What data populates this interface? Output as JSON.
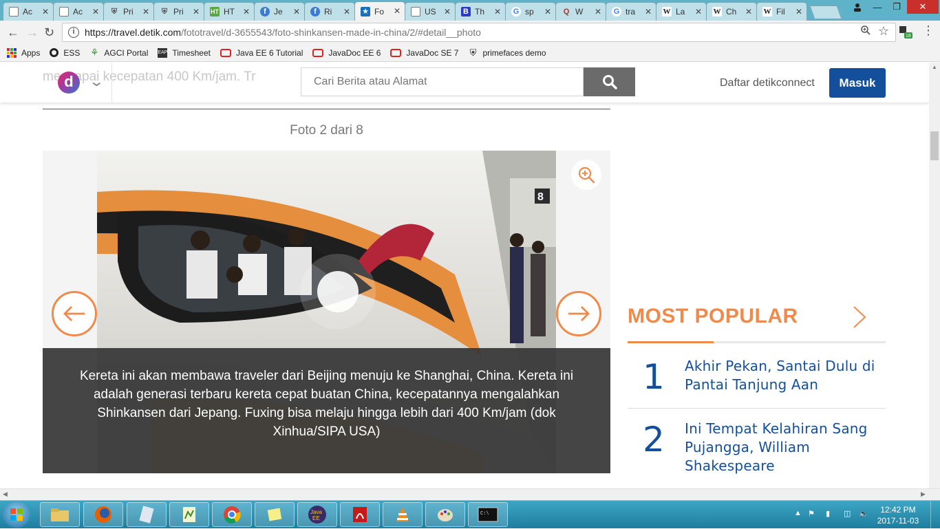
{
  "browser": {
    "tabs": [
      {
        "title": "Ac",
        "favicon": "doc-icon"
      },
      {
        "title": "Ac",
        "favicon": "doc-icon"
      },
      {
        "title": "Pri",
        "favicon": "shield-icon"
      },
      {
        "title": "Pri",
        "favicon": "shield-icon"
      },
      {
        "title": "HT",
        "favicon": "ht-icon"
      },
      {
        "title": "Je",
        "favicon": "facebook-icon"
      },
      {
        "title": "Ri",
        "favicon": "facebook-icon"
      },
      {
        "title": "Fo",
        "favicon": "detik-icon",
        "active": true
      },
      {
        "title": "US",
        "favicon": "doc-icon"
      },
      {
        "title": "Th",
        "favicon": "b-icon"
      },
      {
        "title": "sp",
        "favicon": "google-icon"
      },
      {
        "title": "W",
        "favicon": "quora-icon"
      },
      {
        "title": "tra",
        "favicon": "google-icon"
      },
      {
        "title": "La",
        "favicon": "wikipedia-icon"
      },
      {
        "title": "Ch",
        "favicon": "wikipedia-icon"
      },
      {
        "title": "Fil",
        "favicon": "wikipedia-icon"
      }
    ],
    "url_host": "https://travel.detik.com",
    "url_path": "/fototravel/d-3655543/foto-shinkansen-made-in-china/2/#detail__photo",
    "extension_badge": "18",
    "bookmarks": [
      {
        "label": "Apps",
        "icon": "apps-grid-icon"
      },
      {
        "label": "ESS",
        "icon": "ess-icon"
      },
      {
        "label": "AGCI Portal",
        "icon": "agci-icon"
      },
      {
        "label": "Timesheet",
        "icon": "timesheet-icon"
      },
      {
        "label": "Java EE 6 Tutorial",
        "icon": "oracle-icon"
      },
      {
        "label": "JavaDoc EE 6",
        "icon": "oracle-icon"
      },
      {
        "label": "JavaDoc SE 7",
        "icon": "oracle-icon"
      },
      {
        "label": "primefaces demo",
        "icon": "shield-icon"
      }
    ]
  },
  "site": {
    "logo_letter": "d",
    "ghost_text": "mencapai kecepatan 400 Km/jam. Tr",
    "search_placeholder": "Cari Berita atau Alamat",
    "daftar_label": "Daftar detikconnect",
    "masuk_label": "Masuk"
  },
  "gallery": {
    "counter": "Foto 2 dari 8",
    "caption": "Kereta ini akan membawa traveler dari Beijing menuju ke Shanghai, China. Kereta ini adalah generasi terbaru kereta cepat buatan China, kecepatannya mengalahkan Shinkansen dari Jepang. Fuxing bisa melaju hingga lebih dari 400 Km/jam (dok Xinhua/SIPA USA)",
    "platform_sign": "8"
  },
  "most_popular": {
    "title": "MOST POPULAR",
    "items": [
      {
        "rank": "1",
        "title": "Akhir Pekan, Santai Dulu di Pantai Tanjung Aan"
      },
      {
        "rank": "2",
        "title": "Ini Tempat Kelahiran Sang Pujangga, William Shakespeare"
      }
    ]
  },
  "taskbar": {
    "time": "12:42 PM",
    "date": "2017-11-03"
  },
  "colors": {
    "accent_orange": "#f08a4b",
    "detik_blue": "#134f9b",
    "caption_bg": "#373737"
  }
}
